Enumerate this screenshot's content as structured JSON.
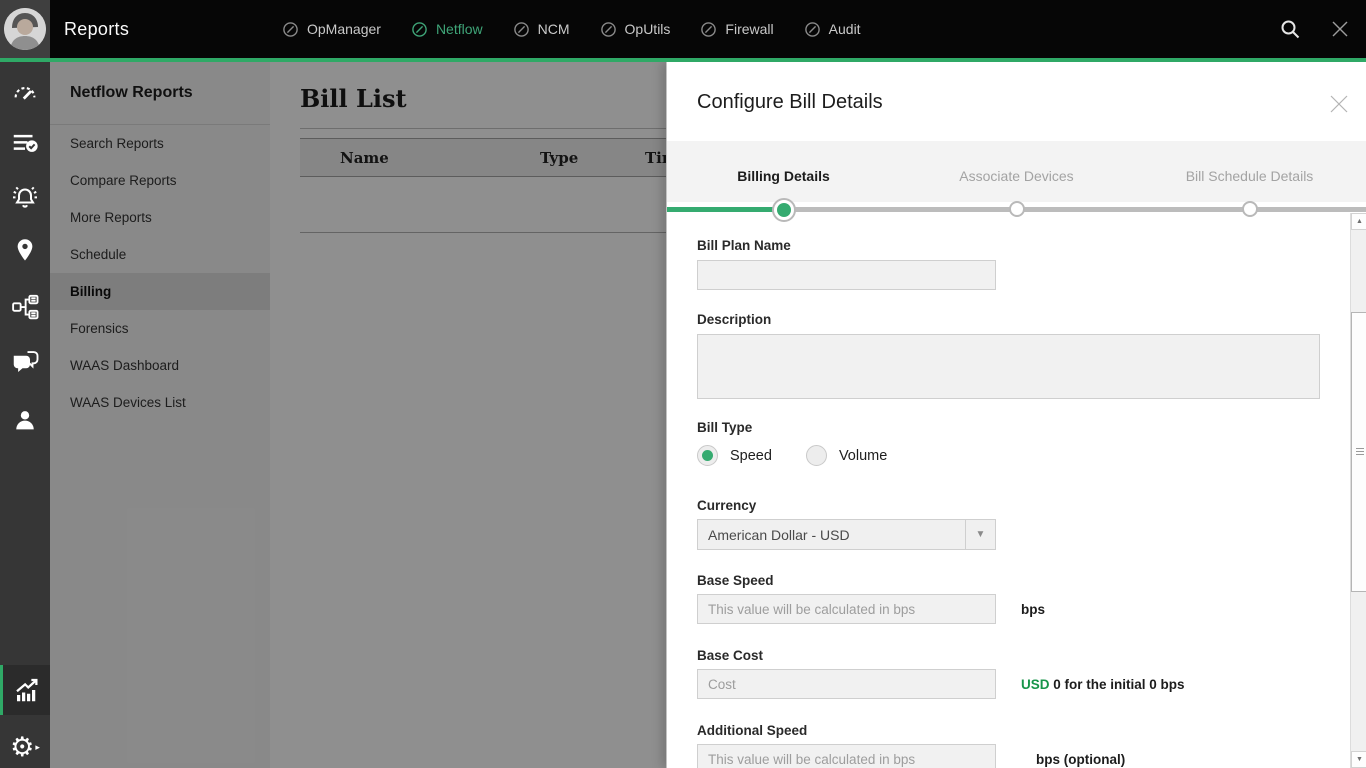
{
  "colors": {
    "accent": "#2fa966",
    "netflow_green": "#3fa578",
    "usd_green": "#18954a"
  },
  "topbar": {
    "title": "Reports",
    "nav": [
      {
        "label": "OpManager",
        "active": false
      },
      {
        "label": "Netflow",
        "active": true
      },
      {
        "label": "NCM",
        "active": false
      },
      {
        "label": "OpUtils",
        "active": false
      },
      {
        "label": "Firewall",
        "active": false
      },
      {
        "label": "Audit",
        "active": false
      }
    ],
    "icons": [
      "user-avatar",
      "search-icon",
      "close-icon"
    ]
  },
  "iconbar": {
    "items": [
      "dashboard-gauge",
      "report-list",
      "alarms-bell",
      "maps-pin",
      "workflow",
      "chat",
      "users",
      "analytics-reports",
      "settings-gear"
    ],
    "active_item": "analytics-reports"
  },
  "sidebar": {
    "title": "Netflow Reports",
    "items": [
      {
        "label": "Search Reports"
      },
      {
        "label": "Compare Reports"
      },
      {
        "label": "More Reports"
      },
      {
        "label": "Schedule"
      },
      {
        "label": "Billing"
      },
      {
        "label": "Forensics"
      },
      {
        "label": "WAAS Dashboard"
      },
      {
        "label": "WAAS Devices List"
      }
    ],
    "selected": "Billing"
  },
  "main": {
    "title": "Bill List",
    "table_headers": [
      "Name",
      "Type",
      "Tim"
    ]
  },
  "modal": {
    "title": "Configure Bill Details",
    "steps": [
      {
        "label": "Billing Details",
        "state": "active"
      },
      {
        "label": "Associate Devices",
        "state": "upcoming"
      },
      {
        "label": "Bill Schedule Details",
        "state": "upcoming"
      }
    ],
    "form": {
      "bill_plan_name": {
        "label": "Bill Plan Name",
        "value": ""
      },
      "description": {
        "label": "Description",
        "value": ""
      },
      "bill_type": {
        "label": "Bill Type",
        "options": [
          {
            "label": "Speed",
            "selected": true
          },
          {
            "label": "Volume",
            "selected": false
          }
        ]
      },
      "currency": {
        "label": "Currency",
        "value": "American Dollar - USD"
      },
      "base_speed": {
        "label": "Base Speed",
        "placeholder": "This value will be calculated in bps",
        "suffix": "bps"
      },
      "base_cost": {
        "label": "Base Cost",
        "placeholder": "Cost",
        "suffix_currency": "USD",
        "suffix": "0 for the initial 0 bps"
      },
      "additional_speed": {
        "label": "Additional Speed",
        "placeholder": "This value will be calculated in bps",
        "suffix": "bps (optional)"
      }
    }
  }
}
